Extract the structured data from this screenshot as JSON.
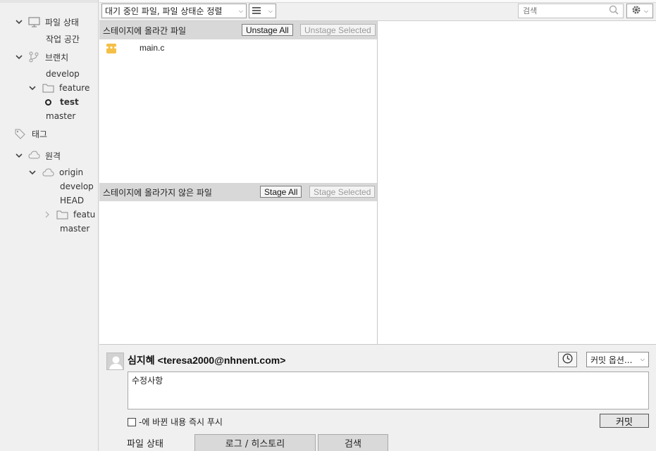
{
  "sidebar": {
    "file_status": "파일 상태",
    "working_copy": "작업 공간",
    "branches": "브랜치",
    "branch_develop": "develop",
    "folder_feature": "feature",
    "branch_test": "test",
    "branch_master": "master",
    "tags": "태그",
    "remotes": "원격",
    "remote_origin": "origin",
    "remote_develop": "develop",
    "remote_head": "HEAD",
    "remote_feature": "featu",
    "remote_master": "master"
  },
  "toolbar": {
    "sort_dropdown": "대기 중인 파일, 파일 상태순 정렬",
    "search_placeholder": "검색"
  },
  "staged": {
    "header": "스테이지에 올라간 파일",
    "unstage_all": "Unstage All",
    "unstage_selected": "Unstage Selected",
    "files": [
      {
        "name": "main.c",
        "status_icon": "modified-icon",
        "status_color": "#f5c048"
      }
    ]
  },
  "unstaged": {
    "header": "스테이지에 올라가지 않은 파일",
    "stage_all": "Stage All",
    "stage_selected": "Stage Selected"
  },
  "commit": {
    "author_name": "심지혜",
    "author_email": "<teresa2000@nhnent.com>",
    "options_label": "커밋 옵션...",
    "message": "수정사항",
    "push_label": "-에 바뀐 내용 즉시 푸시",
    "push_checked": false,
    "commit_button": "커밋"
  },
  "tabs": {
    "file_status": "파일 상태",
    "log_history": "로그 / 히스토리",
    "search": "검색"
  }
}
